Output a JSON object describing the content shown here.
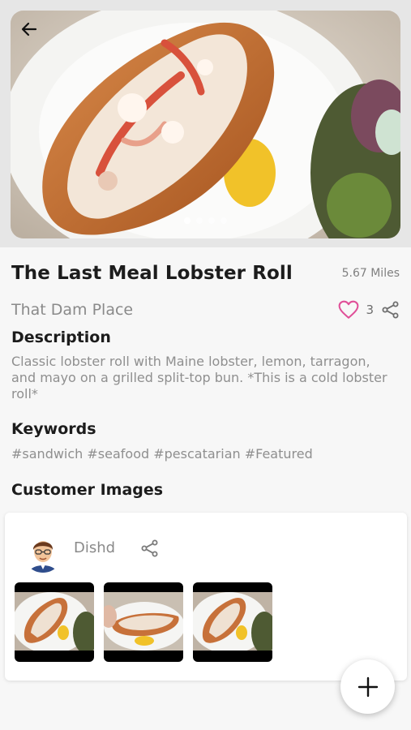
{
  "item": {
    "title": "The Last Meal Lobster Roll",
    "distance": "5.67 Miles",
    "place": "That Dam Place",
    "likes": "3",
    "carousel": {
      "count": 4,
      "active": 0
    }
  },
  "description": {
    "heading": "Description",
    "text": "Classic lobster roll with Maine lobster, lemon, tarragon, and mayo on a grilled split-top bun. *This is a cold lobster roll*"
  },
  "keywords": {
    "heading": "Keywords",
    "text": "#sandwich #seafood #pescatarian #Featured"
  },
  "customer_images": {
    "heading": "Customer Images",
    "user": "Dishd",
    "thumbnail_count": 3
  },
  "colors": {
    "heart": "#e04f98",
    "text_dark": "#1c1c1c",
    "text_muted": "#8f8f8f"
  },
  "icons": {
    "back": "arrow-left-icon",
    "like": "heart-outline-icon",
    "share": "share-icon",
    "add": "plus-icon"
  }
}
